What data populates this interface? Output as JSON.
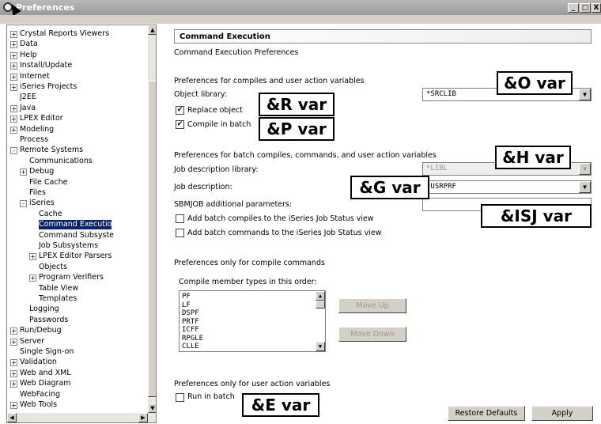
{
  "window": {
    "title": "Preferences"
  },
  "tree": {
    "items": [
      {
        "label": "Crystal Reports Viewers",
        "exp": "+"
      },
      {
        "label": "Data",
        "exp": "+"
      },
      {
        "label": "Help",
        "exp": "+"
      },
      {
        "label": "Install/Update",
        "exp": "+"
      },
      {
        "label": "Internet",
        "exp": "+"
      },
      {
        "label": "iSeries Projects",
        "exp": "+"
      },
      {
        "label": "J2EE",
        "exp": ""
      },
      {
        "label": "Java",
        "exp": "+"
      },
      {
        "label": "LPEX Editor",
        "exp": "+"
      },
      {
        "label": "Modeling",
        "exp": "+"
      },
      {
        "label": "Process",
        "exp": ""
      },
      {
        "label": "Remote Systems",
        "exp": "-"
      },
      {
        "label": "Communications",
        "exp": ""
      },
      {
        "label": "Debug",
        "exp": "+"
      },
      {
        "label": "File Cache",
        "exp": ""
      },
      {
        "label": "Files",
        "exp": ""
      },
      {
        "label": "iSeries",
        "exp": "-"
      },
      {
        "label": "Cache",
        "exp": ""
      },
      {
        "label": "Command Executio",
        "exp": ""
      },
      {
        "label": "Command Subsyste",
        "exp": ""
      },
      {
        "label": "Job Subsystems",
        "exp": ""
      },
      {
        "label": "LPEX Editor Parsers",
        "exp": "+"
      },
      {
        "label": "Objects",
        "exp": ""
      },
      {
        "label": "Program Verifiers",
        "exp": "+"
      },
      {
        "label": "Table View",
        "exp": ""
      },
      {
        "label": "Templates",
        "exp": ""
      },
      {
        "label": "Logging",
        "exp": ""
      },
      {
        "label": "Passwords",
        "exp": ""
      },
      {
        "label": "Run/Debug",
        "exp": "+"
      },
      {
        "label": "Server",
        "exp": "+"
      },
      {
        "label": "Single Sign-on",
        "exp": ""
      },
      {
        "label": "Validation",
        "exp": "+"
      },
      {
        "label": "Web and XML",
        "exp": "+"
      },
      {
        "label": "Web Diagram",
        "exp": "+"
      },
      {
        "label": "WebFacing",
        "exp": ""
      },
      {
        "label": "Web Tools",
        "exp": "+"
      }
    ]
  },
  "page": {
    "heading": "Command Execution",
    "subtitle": "Command Execution Preferences",
    "group1_title": "Preferences for compiles and user action variables",
    "object_library_label": "Object library:",
    "object_library_value": "*SRCLIB",
    "replace_object": "Replace object",
    "compile_in_batch": "Compile in batch",
    "group2_title": "Preferences for batch compiles, commands, and user action variables",
    "job_desc_lib_label": "Job description library:",
    "job_desc_lib_value": "*LIBL",
    "job_desc_label": "Job description:",
    "job_desc_value": "*USRPRF",
    "sbmjob_label": "SBMJOB additional parameters:",
    "add_batch_compiles": "Add batch compiles to the iSeries Job Status view",
    "add_batch_commands": "Add batch commands to the iSeries Job Status view",
    "group3_title": "Preferences only for compile commands",
    "compile_order_label": "Compile member types in this order:",
    "member_types": [
      "PF",
      "LF",
      "DSPF",
      "PRTF",
      "ICFF",
      "RPGLE",
      "CLLE"
    ],
    "move_up": "Move Up",
    "move_down": "Move Down",
    "group4_title": "Preferences only for user action variables",
    "run_in_batch": "Run in batch",
    "restore_defaults": "Restore Defaults",
    "apply": "Apply"
  },
  "annotations": {
    "o_var": "&O var",
    "r_var": "&R var",
    "p_var": "&P var",
    "h_var": "&H var",
    "g_var": "&G var",
    "isj_var": "&ISJ var",
    "e_var": "&E var"
  },
  "check_mark": "✔",
  "icons": {
    "expand": "plus-box-icon",
    "collapse": "minus-box-icon",
    "dropdown": "chevron-down-icon"
  }
}
